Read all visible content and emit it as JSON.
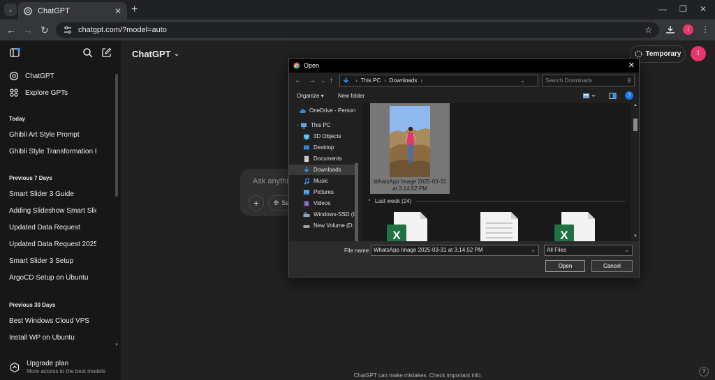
{
  "browser": {
    "tab_title": "ChatGPT",
    "tab_close": "✕",
    "new_tab": "+",
    "url": "chatgpt.com/?model=auto",
    "profile_initial": "I",
    "colors": {
      "tabstrip": "#202124",
      "toolbar": "#35363a",
      "profile": "#e8366c"
    }
  },
  "sidebar": {
    "nav": [
      {
        "label": "ChatGPT",
        "icon": "openai-logo-icon"
      },
      {
        "label": "Explore GPTs",
        "icon": "grid-icon"
      }
    ],
    "sections": [
      {
        "heading": "Today",
        "items": [
          "Ghibli Art Style Prompt",
          "Ghibli Style Transformation Pr"
        ]
      },
      {
        "heading": "Previous 7 Days",
        "items": [
          "Smart Slider 3 Guide",
          "Adding Slideshow Smart Slider",
          "Updated Data Request",
          "Updated Data Request 2025",
          "Smart Slider 3 Setup",
          "ArgoCD Setup on Ubuntu"
        ]
      },
      {
        "heading": "Previous 30 Days",
        "items": [
          "Best Windows Cloud VPS",
          "Install WP on Ubuntu"
        ]
      }
    ],
    "upgrade": {
      "title": "Upgrade plan",
      "subtitle": "More access to the best models"
    }
  },
  "main": {
    "title": "ChatGPT",
    "temporary_label": "Temporary",
    "user_initial": "I",
    "composer_placeholder": "Ask anythin",
    "composer_search_label": "Se",
    "disclaimer": "ChatGPT can make mistakes. Check important info.",
    "help_label": "?"
  },
  "dialog": {
    "title": "Open",
    "address": [
      "This PC",
      "Downloads"
    ],
    "search_placeholder": "Search Downloads",
    "organize_label": "Organize ▾",
    "new_folder_label": "New folder",
    "help_label": "?",
    "nav_items": [
      {
        "label": "OneDrive - Person",
        "icon": "cloud-icon"
      },
      {
        "label": "This PC",
        "icon": "computer-icon"
      },
      {
        "label": "3D Objects",
        "icon": "cube-icon"
      },
      {
        "label": "Desktop",
        "icon": "desktop-icon"
      },
      {
        "label": "Documents",
        "icon": "document-icon"
      },
      {
        "label": "Downloads",
        "icon": "download-arrow-icon",
        "selected": true
      },
      {
        "label": "Music",
        "icon": "music-note-icon"
      },
      {
        "label": "Pictures",
        "icon": "pictures-icon"
      },
      {
        "label": "Videos",
        "icon": "video-icon"
      },
      {
        "label": "Windows-SSD (C",
        "icon": "drive-icon"
      },
      {
        "label": "New Volume (D:",
        "icon": "drive-icon"
      }
    ],
    "selected_file": {
      "name_line1": "WhatsApp Image 2025-03-31",
      "name_line2": "at 3.14.52 PM"
    },
    "group_label": "Last week (24)",
    "file_name_label": "File name:",
    "file_name_value": "WhatsApp Image 2025-03-31 at 3.14.52 PM",
    "file_type_value": "All Files",
    "open_label": "Open",
    "cancel_label": "Cancel"
  }
}
